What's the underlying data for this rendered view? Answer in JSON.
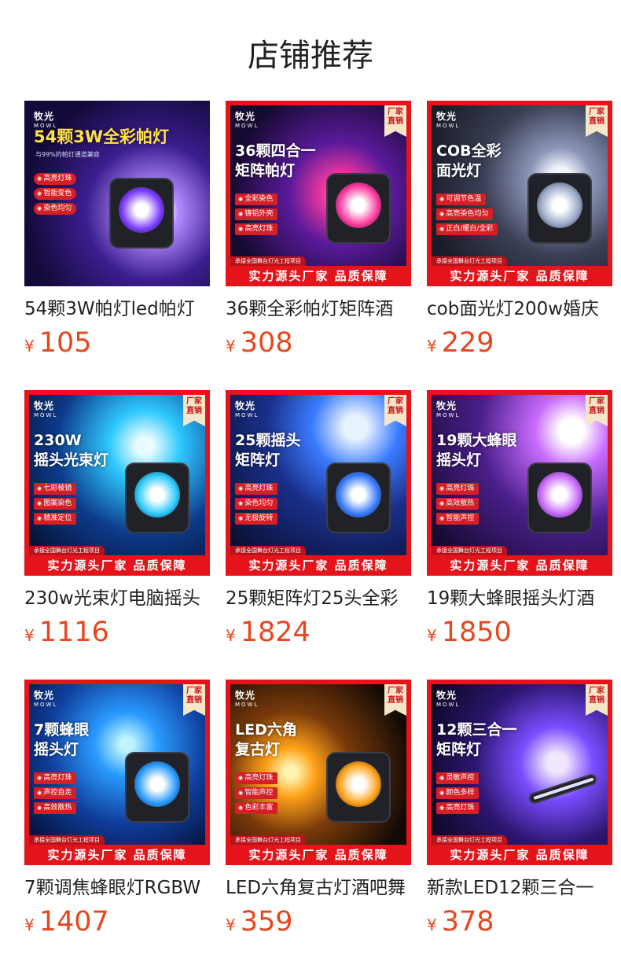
{
  "title": "店铺推荐",
  "products": [
    {
      "name": "54颗3W帕灯led帕灯",
      "currency": "¥",
      "price": "105",
      "logo": "牧光",
      "logo_sub": "MOWL",
      "badge": "",
      "headline": "54颗3W全彩帕灯",
      "subline": "与99%的帕灯通道兼容",
      "features": [
        "高亮灯珠",
        "智能变色",
        "染色均匀"
      ],
      "strip_note": "",
      "strip": "",
      "accent": "#7b3cff"
    },
    {
      "name": "36颗全彩帕灯矩阵酒",
      "currency": "¥",
      "price": "308",
      "logo": "牧光",
      "logo_sub": "MOWL",
      "badge": "厂家直销",
      "headline": "36颗四合一\n矩阵帕灯",
      "subline": "",
      "features": [
        "全彩染色",
        "铸铝外壳",
        "高亮灯珠"
      ],
      "strip_note": "承接全国舞台灯光工程项目",
      "strip": "实力源头厂家 品质保障",
      "accent": "#ff3aa0"
    },
    {
      "name": "cob面光灯200w婚庆",
      "currency": "¥",
      "price": "229",
      "logo": "牧光",
      "logo_sub": "MOWL",
      "badge": "厂家直销",
      "headline": "COB全彩\n面光灯",
      "subline": "",
      "features": [
        "可调节色温",
        "高亮染色均匀",
        "正白/暖白/全彩"
      ],
      "strip_note": "承接全国舞台灯光工程项目",
      "strip": "实力源头厂家 品质保障",
      "accent": "#9aa8c8"
    },
    {
      "name": "230w光束灯电脑摇头",
      "currency": "¥",
      "price": "1116",
      "logo": "牧光",
      "logo_sub": "MOWL",
      "badge": "厂家直销",
      "headline": "230W\n摇头光束灯",
      "subline": "",
      "features": [
        "七彩棱镜",
        "图案染色",
        "精准定位"
      ],
      "strip_note": "承接全国舞台灯光工程项目",
      "strip": "实力源头厂家 品质保障",
      "accent": "#2ec9ff"
    },
    {
      "name": "25颗矩阵灯25头全彩",
      "currency": "¥",
      "price": "1824",
      "logo": "牧光",
      "logo_sub": "MOWL",
      "badge": "厂家直销",
      "headline": "25颗摇头\n矩阵灯",
      "subline": "",
      "features": [
        "高亮灯珠",
        "染色均匀",
        "无极旋转"
      ],
      "strip_note": "承接全国舞台灯光工程项目",
      "strip": "实力源头厂家 品质保障",
      "accent": "#3a7bff"
    },
    {
      "name": "19颗大蜂眼摇头灯酒",
      "currency": "¥",
      "price": "1850",
      "logo": "牧光",
      "logo_sub": "MOWL",
      "badge": "厂家直销",
      "headline": "19颗大蜂眼\n摇头灯",
      "subline": "",
      "features": [
        "高亮灯珠",
        "高效散热",
        "智能声控"
      ],
      "strip_note": "承接全国舞台灯光工程项目",
      "strip": "实力源头厂家 品质保障",
      "accent": "#c86bff"
    },
    {
      "name": "7颗调焦蜂眼灯RGBW",
      "currency": "¥",
      "price": "1407",
      "logo": "牧光",
      "logo_sub": "MOWL",
      "badge": "厂家直销",
      "headline": "7颗蜂眼\n摇头灯",
      "subline": "",
      "features": [
        "高亮灯珠",
        "声控自走",
        "高效散热"
      ],
      "strip_note": "承接全国舞台灯光工程项目",
      "strip": "实力源头厂家 品质保障",
      "accent": "#2a9bff"
    },
    {
      "name": "LED六角复古灯酒吧舞",
      "currency": "¥",
      "price": "359",
      "logo": "牧光",
      "logo_sub": "MOWL",
      "badge": "厂家直销",
      "headline": "LED六角\n复古灯",
      "subline": "",
      "features": [
        "高亮灯珠",
        "智能声控",
        "色彩丰富"
      ],
      "strip_note": "承接全国舞台灯光工程项目",
      "strip": "实力源头厂家 品质保障",
      "accent": "#ffa21a"
    },
    {
      "name": "新款LED12颗三合一",
      "currency": "¥",
      "price": "378",
      "logo": "牧光",
      "logo_sub": "MOWL",
      "badge": "厂家直销",
      "headline": "12颗三合一\n矩阵灯",
      "subline": "",
      "features": [
        "灵敏声控",
        "颜色多样",
        "高亮灯珠"
      ],
      "strip_note": "承接全国舞台灯光工程项目",
      "strip": "实力源头厂家 品质保障",
      "accent": "#7a4dff"
    }
  ]
}
